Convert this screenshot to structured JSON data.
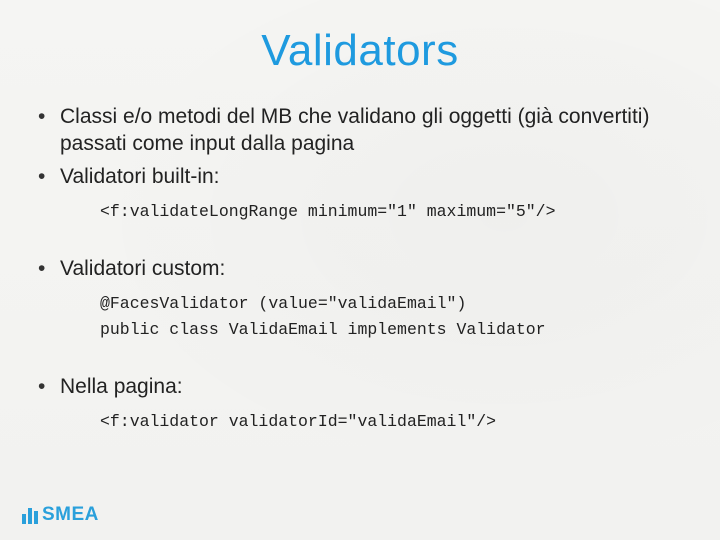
{
  "title": "Validators",
  "bullets": [
    {
      "text": "Classi e/o metodi del MB che validano gli oggetti (già convertiti) passati come input dalla pagina",
      "code": null
    },
    {
      "text": "Validatori built-in:",
      "code": "<f:validateLongRange minimum=\"1\" maximum=\"5\"/>"
    },
    {
      "text": "Validatori custom:",
      "code": "@FacesValidator (value=\"validaEmail\")\npublic class ValidaEmail implements Validator"
    },
    {
      "text": "Nella pagina:",
      "code": "<f:validator validatorId=\"validaEmail\"/>"
    }
  ],
  "footer": {
    "brand": "SMEA"
  }
}
